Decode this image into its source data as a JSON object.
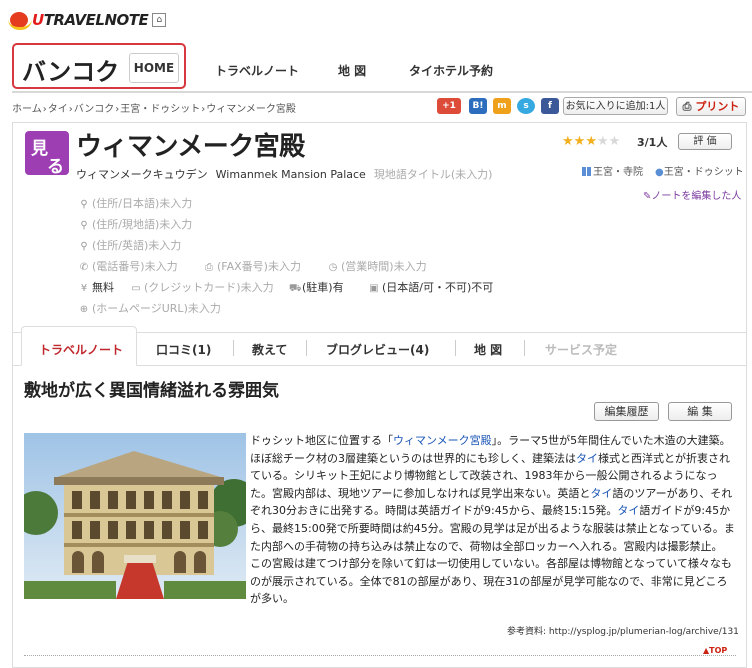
{
  "header": {
    "brand_u": "U",
    "brand_rest": "TRAVELNOTE",
    "city": "バンコク",
    "home": "HOME",
    "nav": [
      "トラベルノート",
      "地 図",
      "タイホテル予約"
    ]
  },
  "breadcrumb": [
    "ホーム",
    "タイ",
    "バンコク",
    "王宮・ドゥシット",
    "ウィマンメーク宮殿"
  ],
  "share": {
    "gplus": "+1",
    "hatena": "B!",
    "mixi": "m",
    "skype": "s",
    "facebook": "f"
  },
  "toolbar": {
    "favorite": "お気に入りに追加:1人",
    "print": "プリント"
  },
  "spot": {
    "badge_1": "見",
    "badge_2": "る",
    "title": "ウィマンメーク宮殿",
    "reading": "ウィマンメークキュウデン",
    "english": "Wimanmek Mansion Palace",
    "local": "現地語タイトル(未入力)",
    "stars": 3,
    "rating": "3/1人",
    "rate_button": "評 価",
    "category": "王宮・寺院",
    "area": "王宮・ドゥシット",
    "editors": "ノートを編集した人"
  },
  "info": {
    "address_ja": "(住所/日本語)未入力",
    "address_local": "(住所/現地語)未入力",
    "address_en": "(住所/英語)未入力",
    "phone": "(電話番号)未入力",
    "fax": "(FAX番号)未入力",
    "hours": "(営業時間)未入力",
    "fee": "無料",
    "card": "(クレジットカード)未入力",
    "parking": "(駐車)有",
    "japanese_label": "(日本語/可・不可)",
    "japanese_value": "不可",
    "homepage": "(ホームページURL)未入力"
  },
  "tabs": [
    {
      "label": "トラベルノート",
      "active": true
    },
    {
      "label": "口コミ(1)"
    },
    {
      "label": "教えて"
    },
    {
      "label": "ブログレビュー(4)"
    },
    {
      "label": "地 図"
    },
    {
      "label": "サービス予定"
    }
  ],
  "article": {
    "heading": "敷地が広く異国情緒溢れる雰囲気",
    "history_button": "編集履歴",
    "edit_button": "編 集",
    "p1": "ドゥシット地区に位置する「",
    "link1": "ウィマンメーク宮殿",
    "p2": "」。ラーマ5世が5年間住んでいた木造の大建築。ほぼ総チーク材の3層建築というのは世界的にも珍しく、建築法は",
    "link2": "タイ",
    "p3": "様式と西洋式とが折衷されている。シリキット王妃により博物館として改装され、1983年から一般公開されるようになった。宮殿内部は、現地ツアーに参加しなければ見学出来ない。英語と",
    "link3": "タイ",
    "p4": "語のツアーがあり、それぞれ30分おきに出発する。時間は英語ガイドが9:45から、最終15:15発。",
    "link4": "タイ",
    "p5": "語ガイドが9:45から、最終15:00発で所要時間は約45分。宮殿の見学は足が出るような服装は禁止となっている。また内部への手荷物の持ち込みは禁止なので、荷物は全部ロッカーへ入れる。宮殿内は撮影禁止。",
    "p6": "この宮殿は建てつけ部分を除いて釘は一切使用していない。各部屋は博物館となっていて様々なものが展示されている。全体で81の部屋があり、現在31の部屋が見学可能なので、非常に見どころが多い。",
    "source": "参考資料: http://ysplog.jp/plumerian-log/archive/131",
    "top": "▲TOP"
  },
  "colors": {
    "accent_red": "#d7373e",
    "badge_purple": "#9d3fb3",
    "link_blue": "#1a55b5"
  }
}
